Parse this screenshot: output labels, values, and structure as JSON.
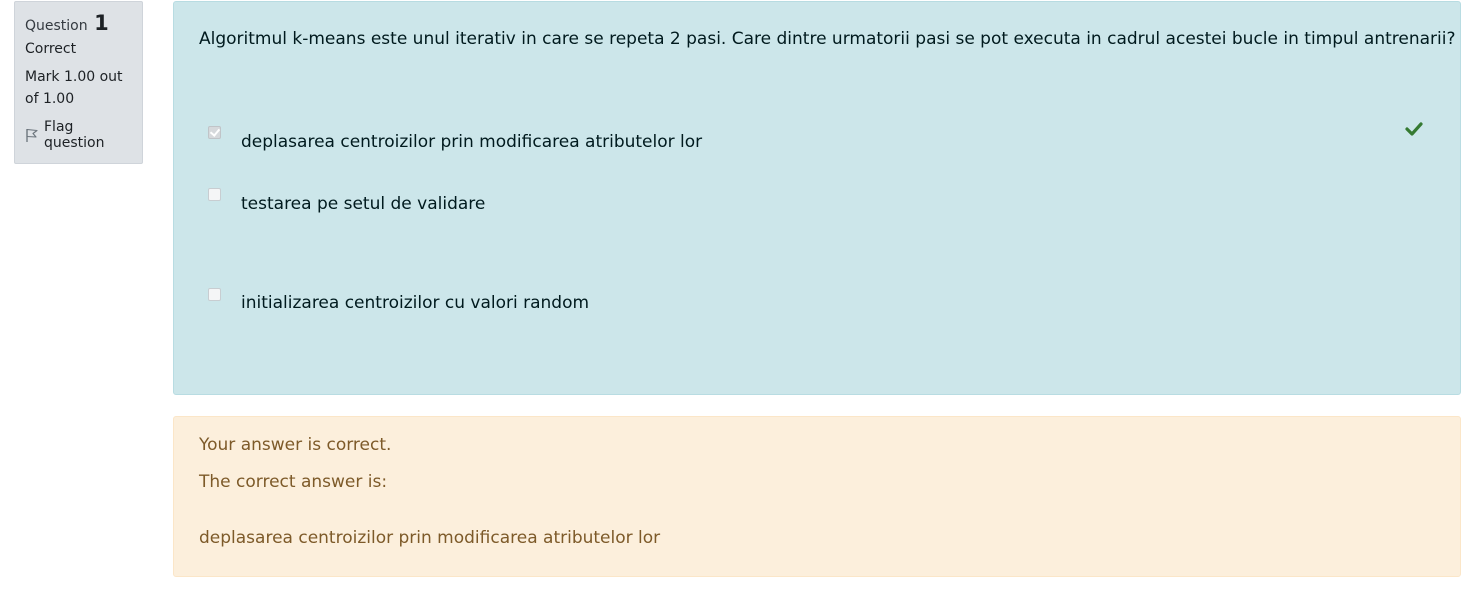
{
  "info": {
    "question_label": "Question",
    "question_number": "1",
    "state": "Correct",
    "grade": "Mark 1.00 out of 1.00",
    "flag_label": "Flag question"
  },
  "question": {
    "text": "Algoritmul k-means este unul iterativ in care se repeta 2 pasi. Care dintre urmatorii pasi se pot executa in cadrul acestei bucle in timpul antrenarii?",
    "answers": [
      {
        "label": "deplasarea centroizilor prin modificarea atributelor lor",
        "checked": true,
        "correct": true
      },
      {
        "label": "testarea pe setul de validare",
        "checked": false
      },
      {
        "label": "initializarea centroizilor cu valori random",
        "checked": false
      }
    ]
  },
  "feedback": {
    "status": "Your answer is correct.",
    "right_answer_label": "The correct answer is:",
    "right_answer": "deplasarea centroizilor prin modificarea atributelor lor"
  },
  "colors": {
    "info_bg": "#dee2e6",
    "formulation_bg": "#cce6ea",
    "outcome_bg": "#fcefdc",
    "correct_green": "#357a32",
    "outcome_text": "#7d5a29"
  }
}
